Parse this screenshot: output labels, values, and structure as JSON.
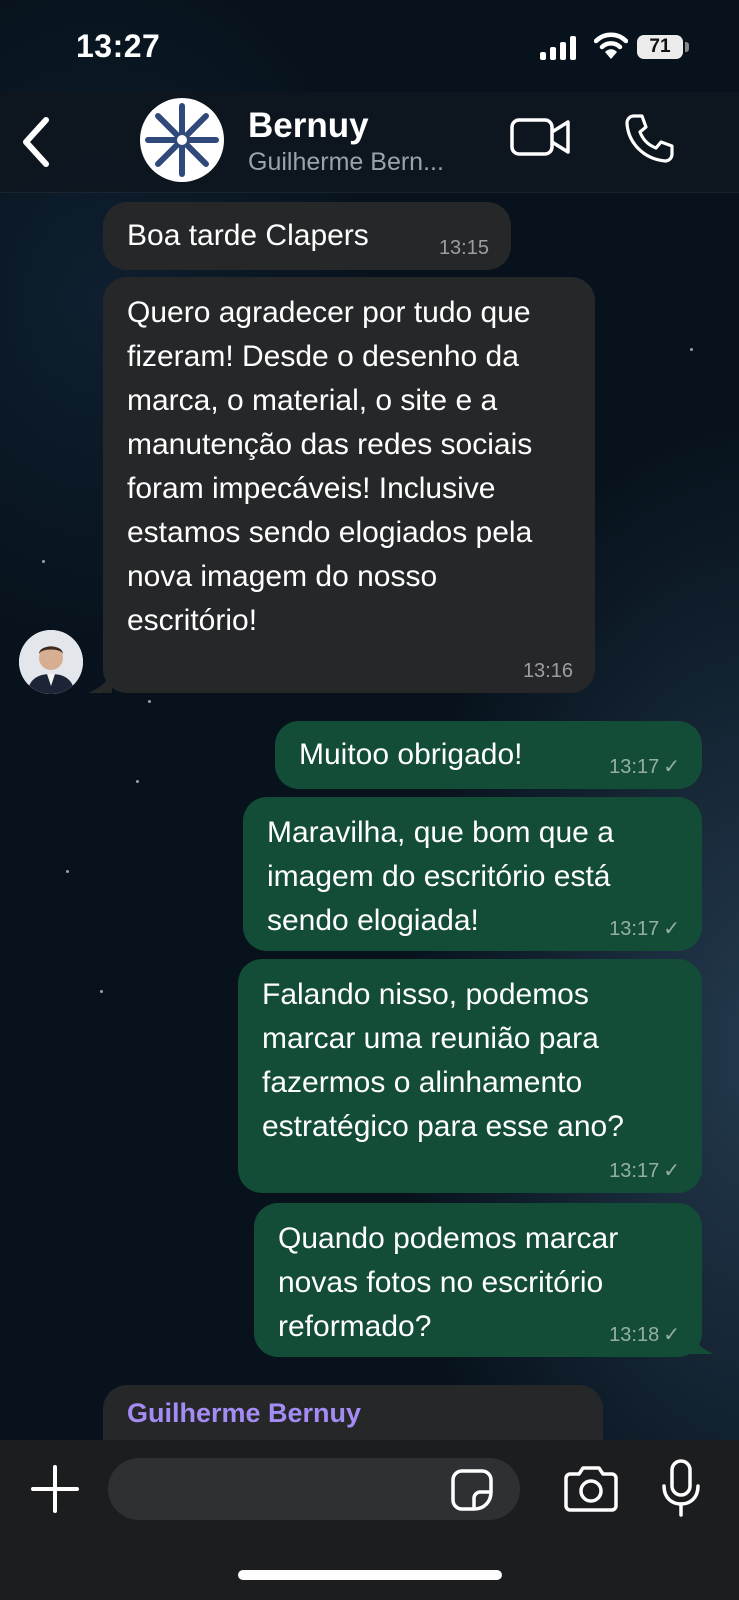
{
  "status_bar": {
    "time": "13:27",
    "battery": "71"
  },
  "header": {
    "contact_name": "Bernuy",
    "contact_subtitle": "Guilherme Bern..."
  },
  "messages": [
    {
      "direction": "in",
      "text": "Boa tarde Clapers",
      "time": "13:15"
    },
    {
      "direction": "in",
      "text": "Quero agradecer por tudo que fizeram! Desde o desenho da marca, o material, o site e a manutenção das redes sociais foram impecáveis! Inclusive estamos sendo elogiados pela nova imagem do nosso escritório!",
      "time": "13:16"
    },
    {
      "direction": "out",
      "text": "Muitoo obrigado!",
      "time": "13:17",
      "status": "sent"
    },
    {
      "direction": "out",
      "text": "Maravilha, que bom que a imagem do escritório está sendo elogiada!",
      "time": "13:17",
      "status": "sent"
    },
    {
      "direction": "out",
      "text": "Falando nisso, podemos marcar uma reunião para fazermos o alinhamento estratégico para esse ano?",
      "time": "13:17",
      "status": "sent"
    },
    {
      "direction": "out",
      "text": "Quando podemos marcar novas fotos no escritório reformado?",
      "time": "13:18",
      "status": "sent"
    },
    {
      "direction": "in",
      "sender": "Guilherme Bernuy"
    }
  ],
  "composer": {
    "placeholder": ""
  },
  "colors": {
    "incoming": "#262729",
    "outgoing": "#134d37",
    "sender_name": "#a58cf5"
  }
}
